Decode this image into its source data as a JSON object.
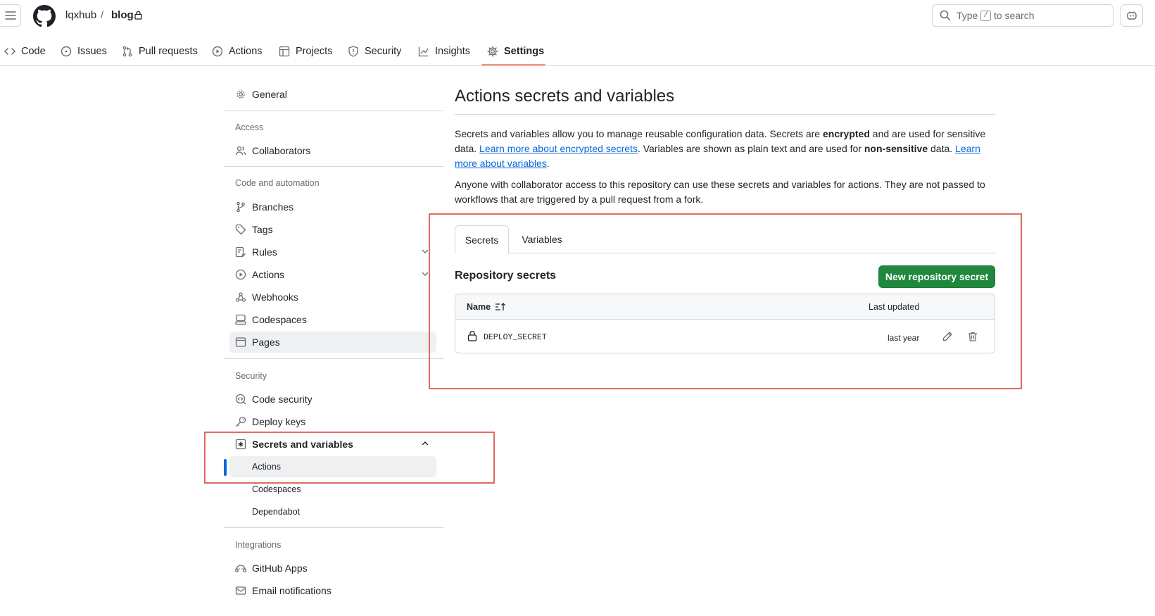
{
  "header": {
    "owner": "lqxhub",
    "separator": "/",
    "repo": "blog",
    "search_placeholder_prefix": "Type",
    "search_key": "/",
    "search_placeholder_suffix": "to search"
  },
  "tabs": [
    {
      "label": "Code",
      "icon": "code-icon"
    },
    {
      "label": "Issues",
      "icon": "issue-icon"
    },
    {
      "label": "Pull requests",
      "icon": "pull-request-icon"
    },
    {
      "label": "Actions",
      "icon": "play-icon"
    },
    {
      "label": "Projects",
      "icon": "table-icon"
    },
    {
      "label": "Security",
      "icon": "shield-icon"
    },
    {
      "label": "Insights",
      "icon": "graph-icon"
    },
    {
      "label": "Settings",
      "icon": "gear-icon"
    }
  ],
  "sidebar": {
    "general": "General",
    "access_heading": "Access",
    "collaborators": "Collaborators",
    "code_automation_heading": "Code and automation",
    "branches": "Branches",
    "tags": "Tags",
    "rules": "Rules",
    "actions": "Actions",
    "webhooks": "Webhooks",
    "codespaces": "Codespaces",
    "pages": "Pages",
    "security_heading": "Security",
    "code_security": "Code security",
    "deploy_keys": "Deploy keys",
    "secrets_and_variables": "Secrets and variables",
    "sub_actions": "Actions",
    "sub_codespaces": "Codespaces",
    "sub_dependabot": "Dependabot",
    "integrations_heading": "Integrations",
    "github_apps": "GitHub Apps",
    "email_notifications": "Email notifications"
  },
  "main": {
    "title": "Actions secrets and variables",
    "p1_a": "Secrets and variables allow you to manage reusable configuration data. Secrets are ",
    "p1_b": "encrypted",
    "p1_c": " and are used for sensitive data. ",
    "p1_link1": "Learn more about encrypted secrets",
    "p1_d": ". Variables are shown as plain text and are used for ",
    "p1_e": "non-sensitive",
    "p1_f": " data. ",
    "p1_link2": "Learn more about variables",
    "p1_g": ".",
    "p2": "Anyone with collaborator access to this repository can use these secrets and variables for actions. They are not passed to workflows that are triggered by a pull request from a fork.",
    "tab_secrets": "Secrets",
    "tab_variables": "Variables",
    "section_title": "Repository secrets",
    "new_button": "New repository secret",
    "col_name": "Name",
    "col_updated": "Last updated",
    "rows": [
      {
        "name": "DEPLOY_SECRET",
        "updated": "last year"
      }
    ]
  },
  "colors": {
    "accent": "#0969da",
    "primary_button": "#1f883d",
    "tab_underline": "#fd8c73",
    "annotation": "#e06b61"
  }
}
